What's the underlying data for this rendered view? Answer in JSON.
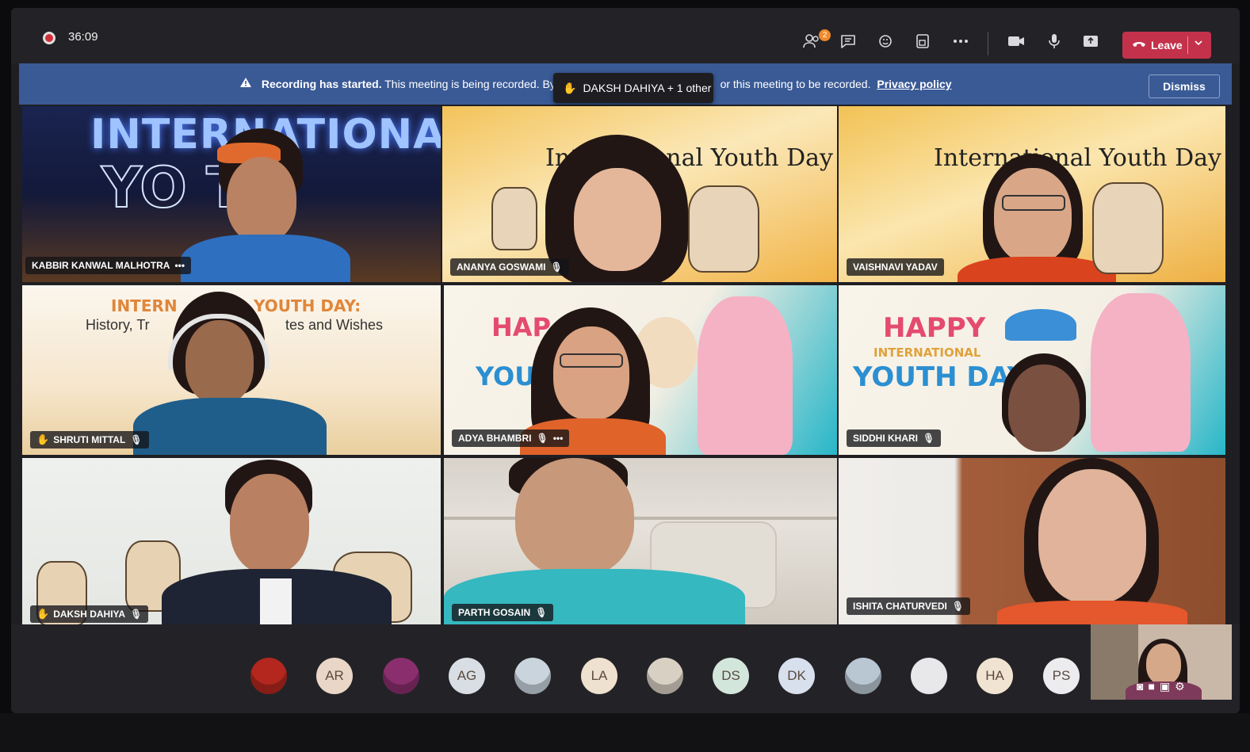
{
  "top_bar": {
    "timer": "36:09",
    "participants_badge": "2",
    "icons": [
      "people-icon",
      "chat-icon",
      "reactions-icon",
      "view-icon",
      "more-icon",
      "camera-icon",
      "mic-icon",
      "share-icon"
    ],
    "leave_label": "Leave"
  },
  "banner": {
    "bold": "Recording has started.",
    "text_before": "This meeting is being recorded. By",
    "text_after": "or this meeting to be recorded.",
    "privacy_link": "Privacy policy",
    "dismiss_label": "Dismiss"
  },
  "raised_hand_toast": "DAKSH DAHIYA + 1 other",
  "tiles": [
    {
      "name": "KABBIR KANWAL MALHOTRA",
      "has_more": true,
      "bg_text": "INTERNATIONAL"
    },
    {
      "name": "ANANYA GOSWAMI",
      "bg_text": "International Youth Day"
    },
    {
      "name": "VAISHNAVI YADAV",
      "bg_text": "International Youth Day"
    },
    {
      "name": "SHRUTI MITTAL",
      "hand_raised": true,
      "bg_text_1": "INTERN",
      "bg_text_2": "YOUTH DAY:",
      "bg_text_3": "History, Tr",
      "bg_text_4": "tes and Wishes"
    },
    {
      "name": "ADYA BHAMBRI",
      "has_more": true,
      "bg_text_1": "HAP",
      "bg_text_2": "YOUT"
    },
    {
      "name": "SIDDHI KHARI",
      "bg_text_1": "HAPPY",
      "bg_text_2": "INTERNATIONAL",
      "bg_text_3": "YOUTH DAY"
    },
    {
      "name": "DAKSH DAHIYA",
      "hand_raised": true
    },
    {
      "name": "PARTH GOSAIN"
    },
    {
      "name": "ISHITA CHATURVEDI"
    }
  ],
  "roster": [
    {
      "initials": "",
      "kind": "photo",
      "color": "#b3271e"
    },
    {
      "initials": "AR",
      "kind": "initials",
      "color": "#e9d6c6"
    },
    {
      "initials": "",
      "kind": "photo",
      "color": "#8a2e6e"
    },
    {
      "initials": "AG",
      "kind": "initials",
      "color": "#d8dee4"
    },
    {
      "initials": "",
      "kind": "photo",
      "color": "#c9d4dc"
    },
    {
      "initials": "LA",
      "kind": "initials",
      "color": "#efe1cf"
    },
    {
      "initials": "",
      "kind": "photo",
      "color": "#d9d0c4"
    },
    {
      "initials": "DS",
      "kind": "initials",
      "color": "#d3e6dc"
    },
    {
      "initials": "DK",
      "kind": "initials",
      "color": "#d8e0ee"
    },
    {
      "initials": "",
      "kind": "photo",
      "color": "#b8c7d2"
    },
    {
      "initials": "",
      "kind": "blank",
      "color": "#e8e8ea"
    },
    {
      "initials": "HA",
      "kind": "initials",
      "color": "#f1e3d1"
    },
    {
      "initials": "PS",
      "kind": "initials",
      "color": "#ececef"
    }
  ]
}
